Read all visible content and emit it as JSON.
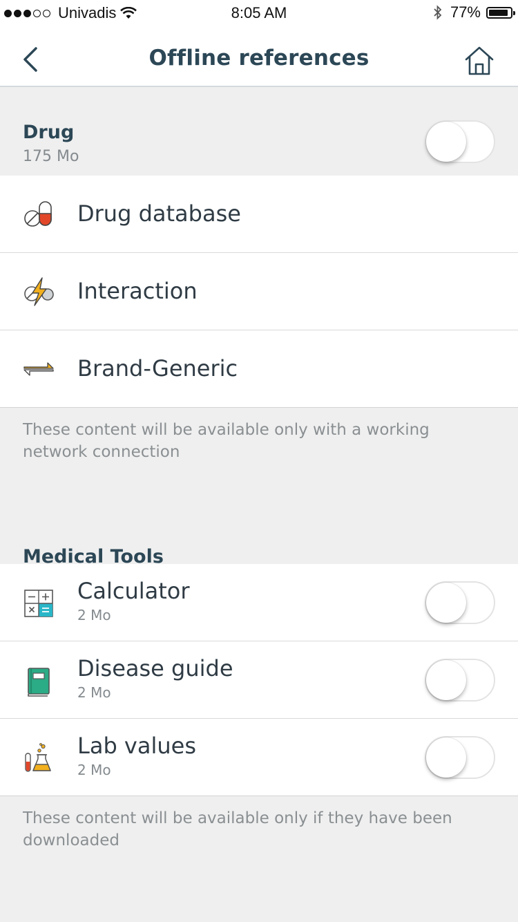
{
  "status_bar": {
    "signal_filled": 3,
    "signal_total": 5,
    "carrier": "Univadis",
    "time": "8:05 AM",
    "battery": "77%"
  },
  "nav": {
    "title": "Offline references",
    "back_icon": "chevron-left-icon",
    "home_icon": "home-icon"
  },
  "drug_section": {
    "title": "Drug",
    "size": "175 Mo",
    "toggle_on": false,
    "items": [
      {
        "label": "Drug database",
        "icon": "pill-icon"
      },
      {
        "label": "Interaction",
        "icon": "interaction-icon"
      },
      {
        "label": "Brand-Generic",
        "icon": "swap-arrows-icon"
      }
    ],
    "note": "These content will be available only with a working network connection"
  },
  "tools_section": {
    "title": "Medical Tools",
    "items": [
      {
        "label": "Calculator",
        "size": "2 Mo",
        "icon": "calculator-icon",
        "toggle_on": false
      },
      {
        "label": "Disease guide",
        "size": "2 Mo",
        "icon": "book-icon",
        "toggle_on": false
      },
      {
        "label": "Lab values",
        "size": "2 Mo",
        "icon": "lab-flask-icon",
        "toggle_on": false
      }
    ],
    "note": "These content will be available only if they have been downloaded"
  },
  "colors": {
    "title_text": "#2c4756",
    "background": "#efefef",
    "pill_red": "#e2472a",
    "bolt_yellow": "#f2b01e",
    "book_green": "#2bab86",
    "calc_teal": "#29b6c8"
  }
}
